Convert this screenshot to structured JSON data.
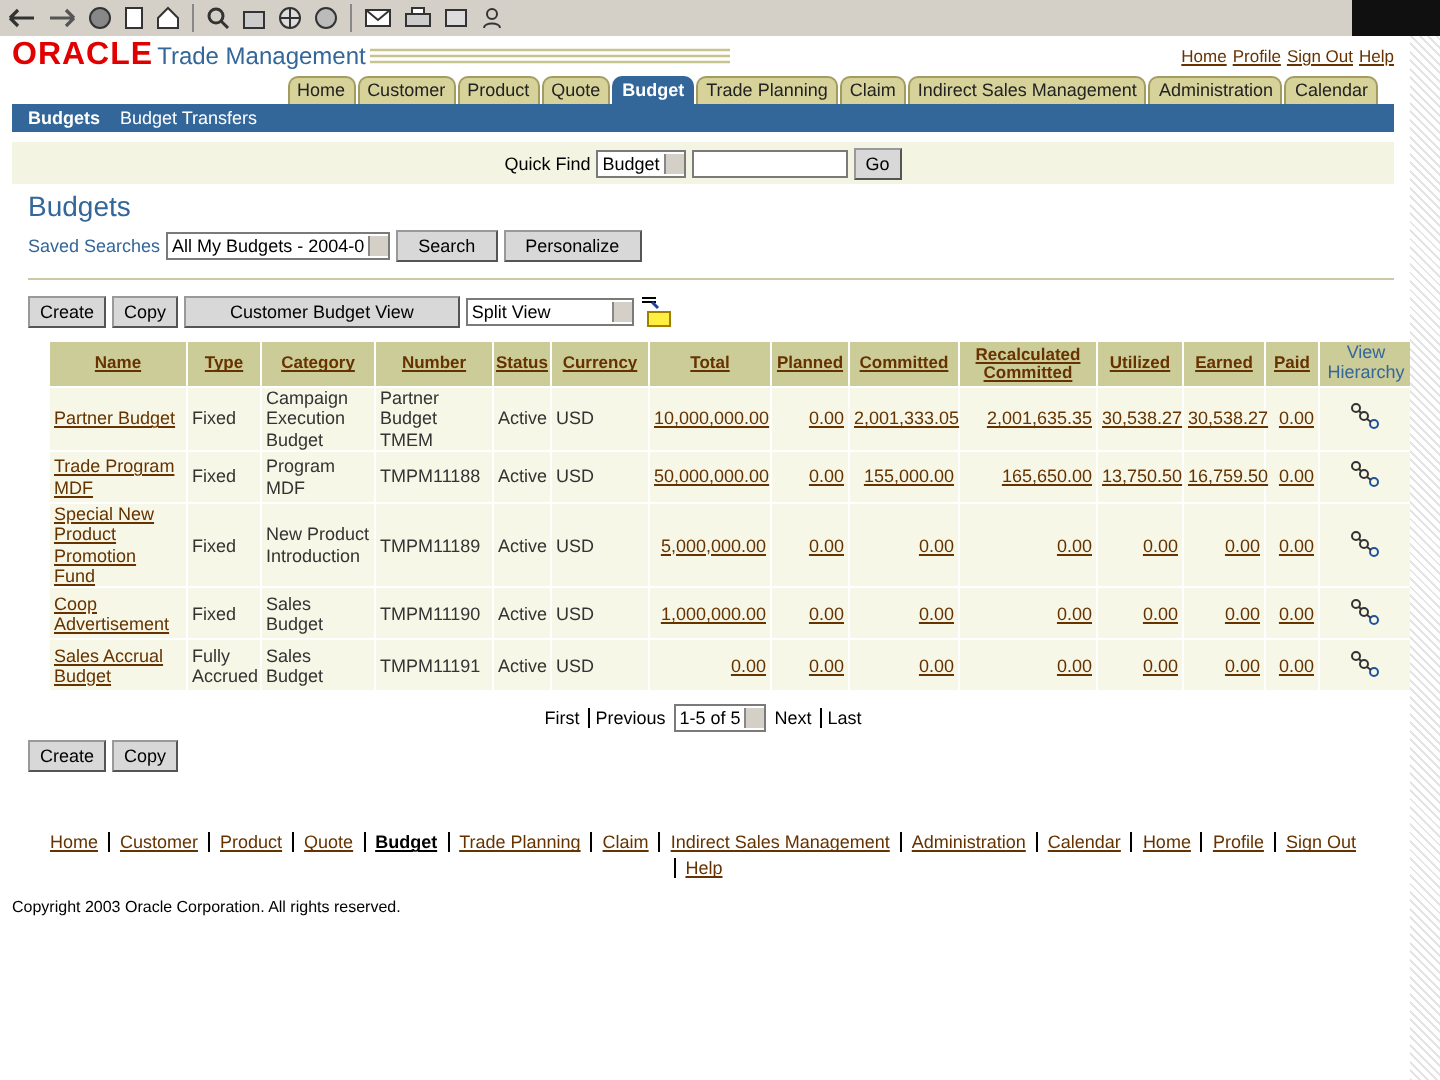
{
  "brand": {
    "logo": "ORACLE",
    "product": "Trade Management"
  },
  "header_links": [
    "Home",
    "Profile",
    "Sign Out",
    "Help"
  ],
  "tabs": [
    {
      "label": "Home",
      "selected": false
    },
    {
      "label": "Customer",
      "selected": false
    },
    {
      "label": "Product",
      "selected": false
    },
    {
      "label": "Quote",
      "selected": false
    },
    {
      "label": "Budget",
      "selected": true
    },
    {
      "label": "Trade Planning",
      "selected": false
    },
    {
      "label": "Claim",
      "selected": false
    },
    {
      "label": "Indirect Sales Management",
      "selected": false
    },
    {
      "label": "Administration",
      "selected": false
    },
    {
      "label": "Calendar",
      "selected": false
    }
  ],
  "subtabs": [
    {
      "label": "Budgets",
      "selected": true
    },
    {
      "label": "Budget Transfers",
      "selected": false
    }
  ],
  "quick_find": {
    "label": "Quick Find",
    "select": "Budget",
    "button": "Go"
  },
  "page_title": "Budgets",
  "saved_searches": {
    "label": "Saved Searches",
    "select": "All My Budgets - 2004-0",
    "buttons": [
      "Search",
      "Personalize"
    ]
  },
  "actions": [
    "Create",
    "Copy",
    "Customer Budget View"
  ],
  "view_select": "Split View",
  "table": {
    "columns": [
      {
        "label": "Name",
        "kind": "link"
      },
      {
        "label": "Type",
        "kind": "text"
      },
      {
        "label": "Category",
        "kind": "text"
      },
      {
        "label": "Number",
        "kind": "text"
      },
      {
        "label": "Status",
        "kind": "text"
      },
      {
        "label": "Currency",
        "kind": "text"
      },
      {
        "label": "Total",
        "kind": "amount"
      },
      {
        "label": "Planned",
        "kind": "amount"
      },
      {
        "label": "Committed",
        "kind": "amount"
      },
      {
        "label": "Recalculated Committed",
        "kind": "amount"
      },
      {
        "label": "Utilized",
        "kind": "amount"
      },
      {
        "label": "Earned",
        "kind": "amount"
      },
      {
        "label": "Paid",
        "kind": "amount"
      },
      {
        "label": "View Hierarchy",
        "kind": "icon"
      }
    ],
    "rows": [
      [
        "Partner Budget",
        "Fixed",
        "Campaign Execution Budget",
        "Partner Budget TMEM",
        "Active",
        "USD",
        "10,000,000.00",
        "0.00",
        "2,001,333.05",
        "2,001,635.35",
        "30,538.27",
        "30,538.27",
        "0.00",
        ""
      ],
      [
        "Trade Program MDF",
        "Fixed",
        "Program MDF",
        "TMPM11188",
        "Active",
        "USD",
        "50,000,000.00",
        "0.00",
        "155,000.00",
        "165,650.00",
        "13,750.50",
        "16,759.50",
        "0.00",
        ""
      ],
      [
        "Special New Product Promotion Fund",
        "Fixed",
        "New Product Introduction",
        "TMPM11189",
        "Active",
        "USD",
        "5,000,000.00",
        "0.00",
        "0.00",
        "0.00",
        "0.00",
        "0.00",
        "0.00",
        ""
      ],
      [
        "Coop Advertisement",
        "Fixed",
        "Sales Budget",
        "TMPM11190",
        "Active",
        "USD",
        "1,000,000.00",
        "0.00",
        "0.00",
        "0.00",
        "0.00",
        "0.00",
        "0.00",
        ""
      ],
      [
        "Sales Accrual Budget",
        "Fully Accrued",
        "Sales Budget",
        "TMPM11191",
        "Active",
        "USD",
        "0.00",
        "0.00",
        "0.00",
        "0.00",
        "0.00",
        "0.00",
        "0.00",
        ""
      ]
    ]
  },
  "pagination": {
    "first": "First",
    "previous": "Previous",
    "range": "1-5 of 5",
    "next": "Next",
    "last": "Last"
  },
  "bottom_actions": [
    "Create",
    "Copy"
  ],
  "footer_links": [
    {
      "label": "Home",
      "selected": false
    },
    {
      "label": "Customer",
      "selected": false
    },
    {
      "label": "Product",
      "selected": false
    },
    {
      "label": "Quote",
      "selected": false
    },
    {
      "label": "Budget",
      "selected": true
    },
    {
      "label": "Trade Planning",
      "selected": false
    },
    {
      "label": "Claim",
      "selected": false
    },
    {
      "label": "Indirect Sales Management",
      "selected": false
    },
    {
      "label": "Administration",
      "selected": false
    },
    {
      "label": "Calendar",
      "selected": false
    },
    {
      "label": "Home",
      "selected": false
    },
    {
      "label": "Profile",
      "selected": false
    },
    {
      "label": "Sign Out",
      "selected": false
    },
    {
      "label": "Help",
      "selected": false
    }
  ],
  "copyright": "Copyright 2003 Oracle Corporation. All rights reserved."
}
